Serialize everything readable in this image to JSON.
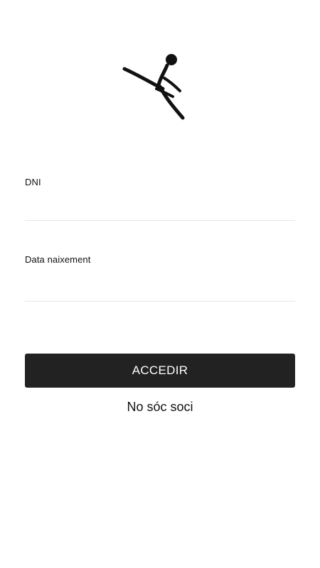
{
  "logo": {
    "icon": "jumping-athlete-logo",
    "color": "#111111"
  },
  "form": {
    "dni": {
      "label": "DNI",
      "value": "",
      "placeholder": ""
    },
    "birth_date": {
      "label": "Data naixement",
      "value": "",
      "placeholder": ""
    },
    "submit_label": "ACCEDIR",
    "not_member_label": "No sóc soci"
  },
  "colors": {
    "button_background": "#222222",
    "button_text": "#ffffff",
    "divider": "#e6e6e6"
  }
}
